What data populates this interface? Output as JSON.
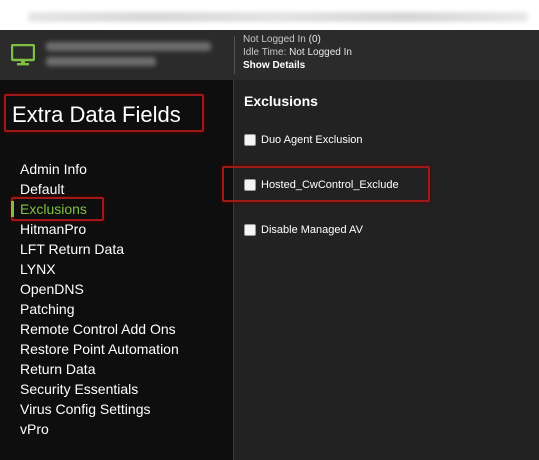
{
  "header": {
    "status": {
      "logged_in_label": "Not Logged In",
      "logged_in_value": "(0)",
      "idle_label": "Idle Time:",
      "idle_value": "Not Logged In",
      "details_label": "Show Details"
    },
    "icon": "monitor-icon"
  },
  "sidebar": {
    "title": "Extra Data Fields",
    "items": [
      {
        "label": "Admin Info"
      },
      {
        "label": "Default"
      },
      {
        "label": "Exclusions",
        "active": true
      },
      {
        "label": "HitmanPro"
      },
      {
        "label": "LFT Return Data"
      },
      {
        "label": "LYNX"
      },
      {
        "label": "OpenDNS"
      },
      {
        "label": "Patching"
      },
      {
        "label": "Remote Control Add Ons"
      },
      {
        "label": "Restore Point Automation"
      },
      {
        "label": "Return Data"
      },
      {
        "label": "Security Essentials"
      },
      {
        "label": "Virus Config Settings"
      },
      {
        "label": "vPro"
      }
    ]
  },
  "main": {
    "section_title": "Exclusions",
    "checkboxes": [
      {
        "label": "Duo Agent Exclusion",
        "checked": false
      },
      {
        "label": "Hosted_CwControl_Exclude",
        "checked": false
      },
      {
        "label": "Disable Managed AV",
        "checked": false
      }
    ]
  },
  "colors": {
    "accent_green": "#7ec043",
    "highlight_red": "#a01818",
    "header_bg": "#2b2b2b",
    "sidebar_bg": "#0e0e0e",
    "main_bg": "#222222"
  }
}
